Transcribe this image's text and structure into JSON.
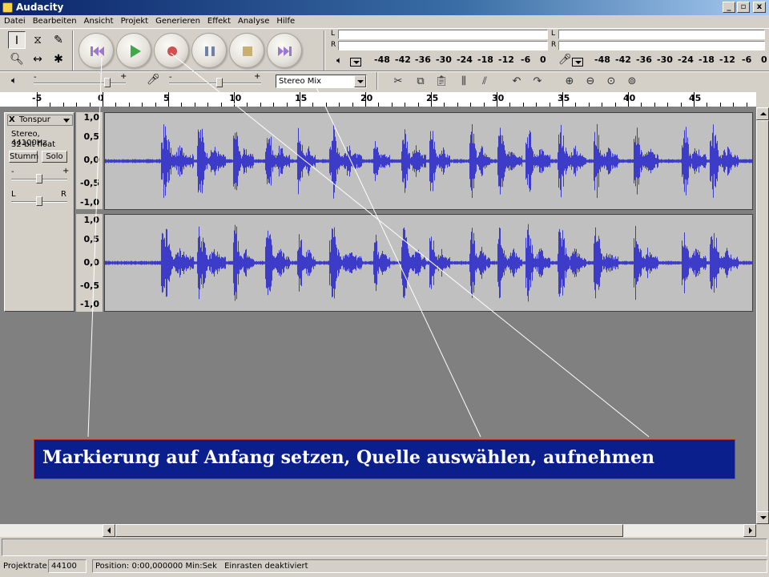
{
  "window": {
    "title": "Audacity",
    "controls": [
      "_",
      "▫",
      "x"
    ]
  },
  "menu": [
    "Datei",
    "Bearbeiten",
    "Ansicht",
    "Projekt",
    "Generieren",
    "Effekt",
    "Analyse",
    "Hilfe"
  ],
  "tools": [
    {
      "name": "selection-tool",
      "glyph": "I",
      "selected": true
    },
    {
      "name": "envelope-tool",
      "glyph": "⧖"
    },
    {
      "name": "draw-tool",
      "glyph": "✎"
    },
    {
      "name": "zoom-tool",
      "glyph": "🔍︎"
    },
    {
      "name": "timeshift-tool",
      "glyph": "↔"
    },
    {
      "name": "multi-tool",
      "glyph": "✱"
    }
  ],
  "transport": [
    {
      "name": "skip-to-start-button",
      "icon": "skip-to-start-icon"
    },
    {
      "name": "play-button",
      "icon": "play-icon"
    },
    {
      "name": "record-button",
      "icon": "record-icon"
    },
    {
      "name": "pause-button",
      "icon": "pause-icon"
    },
    {
      "name": "stop-button",
      "icon": "stop-icon"
    },
    {
      "name": "skip-to-end-button",
      "icon": "skip-to-end-icon"
    }
  ],
  "meters": {
    "l": "L",
    "r": "R",
    "scale": [
      "-48",
      "-42",
      "-36",
      "-30",
      "-24",
      "-18",
      "-12",
      "-6",
      "0"
    ]
  },
  "mixer": {
    "minus": "-",
    "plus": "+",
    "output_volume": 0.8,
    "input_volume": 0.55
  },
  "input_source": "Stereo Mix",
  "ruler": {
    "labels": [
      "-5",
      "0",
      "5",
      "10",
      "15",
      "20",
      "25",
      "30",
      "35",
      "40",
      "45"
    ],
    "start": -5,
    "end": 50
  },
  "track": {
    "name": "Tonspur",
    "close": "X",
    "info1": "Stereo, 44100Hz",
    "info2": "32-bit float",
    "mute": "Stumm",
    "solo": "Solo",
    "gain_minus": "-",
    "gain_plus": "+",
    "pan_left": "L",
    "pan_right": "R",
    "gain": 0.5,
    "pan": 0.5,
    "scale": [
      "1,0",
      "0,5",
      "0,0",
      "-0,5",
      "-1,0"
    ]
  },
  "status": {
    "rate_label": "Projektrate:",
    "rate_value": "44100",
    "position": "Position: 0:00,000000 Min:Sek",
    "snap": "Einrasten deaktiviert"
  },
  "callout": "Markierung auf Anfang setzen, Quelle auswählen, aufnehmen",
  "colors": {
    "wave": "#3c3cc8",
    "wave_bg": "#c0c0c0",
    "callout_bg": "#0a1e8c",
    "title": "#0a246a"
  }
}
